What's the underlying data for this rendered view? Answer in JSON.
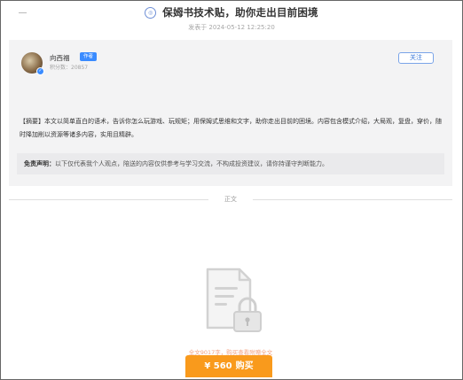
{
  "header": {
    "title": "保姆书技术贴，助你走出目前困境",
    "publish_time": "发表于 2024-05-12 12:25:20"
  },
  "author": {
    "name": "向西福",
    "tag": "作者",
    "stats": "积分数：20857",
    "follow_label": "关注"
  },
  "summary": {
    "text": "【摘要】本文以简单直白的语术，告诉你怎么玩游戏、玩规矩；用保姆式思维和文字，助你走出目前的困境。内容包含模式介绍，大局观，复盘，穿价，随时降加削以资源等诸多内容，实用且精辟。"
  },
  "disclaimer": {
    "label": "免责声明：",
    "text": "以下仅代表我个人观点，陪送的内容仅供参考与学习交流，不构成投资建议，请你持谨守判断能力。"
  },
  "body": {
    "divider_label": "正文",
    "unlock_note": "全文9017字，购买查看附赠全文",
    "buy_price": "¥ 560",
    "buy_label": "购买"
  },
  "colors": {
    "accent": "#3a8bff",
    "buy_button": "#f99a1c",
    "unlock_note": "#f3a383"
  },
  "icons": {
    "title": "site-logo-icon",
    "verified": "verified-badge-icon",
    "locked": "locked-document-icon"
  }
}
